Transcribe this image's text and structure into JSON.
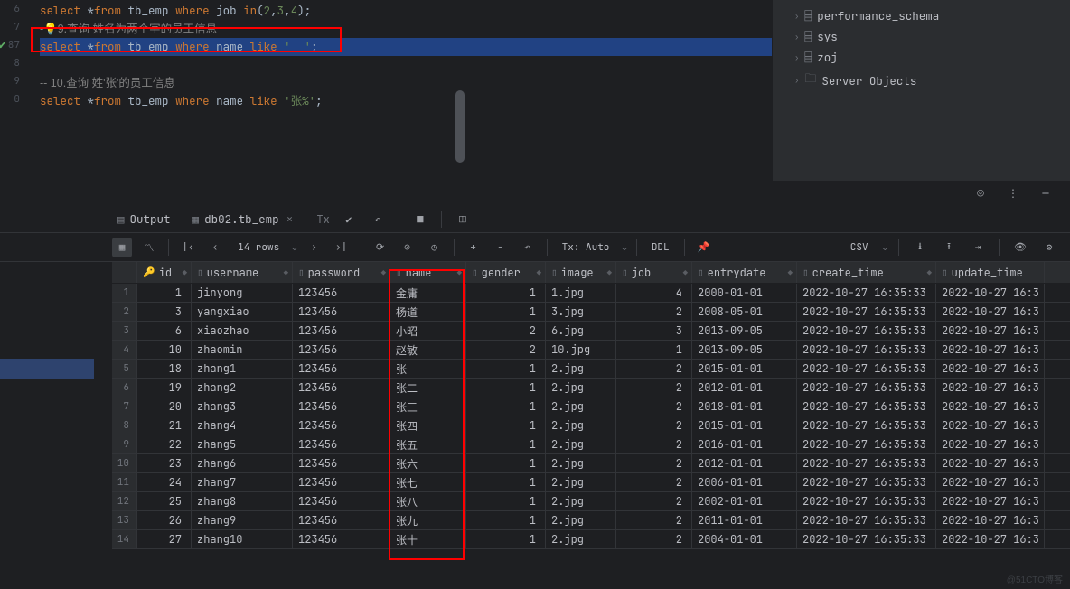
{
  "editor": {
    "lines": [
      {
        "num": "6",
        "pre": "",
        "kw": "select",
        "mid": " *",
        "kw2": "from",
        "mid2": " tb_emp ",
        "kw3": "where",
        "mid3": " job ",
        "kw4": "in",
        "post": "(",
        "str": "2",
        "post2": ",",
        "str2": "3",
        "post3": ",",
        "str3": "4",
        "post4": ");"
      },
      {
        "num": "7",
        "comment": "-💡9.查询 姓名为两个字的员工信息"
      },
      {
        "num": "87",
        "check": true,
        "highlight": true,
        "pre": "",
        "kw": "select",
        "mid": " *",
        "kw2": "from",
        "mid2": " tb_emp ",
        "kw3": "where",
        "mid3": " name ",
        "kw4": "like",
        "post": " ",
        "str": "'__'",
        "post2": ";"
      },
      {
        "num": "8",
        "blank": true
      },
      {
        "num": "9",
        "comment": "-- 10.查询 姓'张'的员工信息"
      },
      {
        "num": "0",
        "pre": "",
        "kw": "select",
        "mid": " *",
        "kw2": "from",
        "mid2": " tb_emp ",
        "kw3": "where",
        "mid3": " name ",
        "kw4": "like",
        "post": " ",
        "str": "'张%'",
        "post2": ";"
      }
    ]
  },
  "sidebar": {
    "items": [
      {
        "label": "performance_schema",
        "icon": "schema"
      },
      {
        "label": "sys",
        "icon": "schema"
      },
      {
        "label": "zoj",
        "icon": "schema"
      },
      {
        "label": "Server Objects",
        "icon": "folder"
      }
    ]
  },
  "tabs": {
    "output_label": "Output",
    "table_label": "db02.tb_emp",
    "tx_label": "Tx"
  },
  "toolbar": {
    "rows_label": "14 rows",
    "tx_auto": "Tx: Auto",
    "ddl": "DDL",
    "csv": "CSV"
  },
  "grid": {
    "columns": [
      "id",
      "username",
      "password",
      "name",
      "gender",
      "image",
      "job",
      "entrydate",
      "create_time",
      "update_time"
    ],
    "rows": [
      {
        "n": "1",
        "id": "1",
        "username": "jinyong",
        "password": "123456",
        "name": "金庸",
        "gender": "1",
        "image": "1.jpg",
        "job": "4",
        "entrydate": "2000-01-01",
        "create": "2022-10-27 16:35:33",
        "update": "2022-10-27 16:3"
      },
      {
        "n": "2",
        "id": "3",
        "username": "yangxiao",
        "password": "123456",
        "name": "杨道",
        "gender": "1",
        "image": "3.jpg",
        "job": "2",
        "entrydate": "2008-05-01",
        "create": "2022-10-27 16:35:33",
        "update": "2022-10-27 16:3"
      },
      {
        "n": "3",
        "id": "6",
        "username": "xiaozhao",
        "password": "123456",
        "name": "小昭",
        "gender": "2",
        "image": "6.jpg",
        "job": "3",
        "entrydate": "2013-09-05",
        "create": "2022-10-27 16:35:33",
        "update": "2022-10-27 16:3"
      },
      {
        "n": "4",
        "id": "10",
        "username": "zhaomin",
        "password": "123456",
        "name": "赵敏",
        "gender": "2",
        "image": "10.jpg",
        "job": "1",
        "entrydate": "2013-09-05",
        "create": "2022-10-27 16:35:33",
        "update": "2022-10-27 16:3"
      },
      {
        "n": "5",
        "id": "18",
        "username": "zhang1",
        "password": "123456",
        "name": "张一",
        "gender": "1",
        "image": "2.jpg",
        "job": "2",
        "entrydate": "2015-01-01",
        "create": "2022-10-27 16:35:33",
        "update": "2022-10-27 16:3"
      },
      {
        "n": "6",
        "id": "19",
        "username": "zhang2",
        "password": "123456",
        "name": "张二",
        "gender": "1",
        "image": "2.jpg",
        "job": "2",
        "entrydate": "2012-01-01",
        "create": "2022-10-27 16:35:33",
        "update": "2022-10-27 16:3"
      },
      {
        "n": "7",
        "id": "20",
        "username": "zhang3",
        "password": "123456",
        "name": "张三",
        "gender": "1",
        "image": "2.jpg",
        "job": "2",
        "entrydate": "2018-01-01",
        "create": "2022-10-27 16:35:33",
        "update": "2022-10-27 16:3"
      },
      {
        "n": "8",
        "id": "21",
        "username": "zhang4",
        "password": "123456",
        "name": "张四",
        "gender": "1",
        "image": "2.jpg",
        "job": "2",
        "entrydate": "2015-01-01",
        "create": "2022-10-27 16:35:33",
        "update": "2022-10-27 16:3"
      },
      {
        "n": "9",
        "id": "22",
        "username": "zhang5",
        "password": "123456",
        "name": "张五",
        "gender": "1",
        "image": "2.jpg",
        "job": "2",
        "entrydate": "2016-01-01",
        "create": "2022-10-27 16:35:33",
        "update": "2022-10-27 16:3"
      },
      {
        "n": "10",
        "id": "23",
        "username": "zhang6",
        "password": "123456",
        "name": "张六",
        "gender": "1",
        "image": "2.jpg",
        "job": "2",
        "entrydate": "2012-01-01",
        "create": "2022-10-27 16:35:33",
        "update": "2022-10-27 16:3"
      },
      {
        "n": "11",
        "id": "24",
        "username": "zhang7",
        "password": "123456",
        "name": "张七",
        "gender": "1",
        "image": "2.jpg",
        "job": "2",
        "entrydate": "2006-01-01",
        "create": "2022-10-27 16:35:33",
        "update": "2022-10-27 16:3"
      },
      {
        "n": "12",
        "id": "25",
        "username": "zhang8",
        "password": "123456",
        "name": "张八",
        "gender": "1",
        "image": "2.jpg",
        "job": "2",
        "entrydate": "2002-01-01",
        "create": "2022-10-27 16:35:33",
        "update": "2022-10-27 16:3"
      },
      {
        "n": "13",
        "id": "26",
        "username": "zhang9",
        "password": "123456",
        "name": "张九",
        "gender": "1",
        "image": "2.jpg",
        "job": "2",
        "entrydate": "2011-01-01",
        "create": "2022-10-27 16:35:33",
        "update": "2022-10-27 16:3"
      },
      {
        "n": "14",
        "id": "27",
        "username": "zhang10",
        "password": "123456",
        "name": "张十",
        "gender": "1",
        "image": "2.jpg",
        "job": "2",
        "entrydate": "2004-01-01",
        "create": "2022-10-27 16:35:33",
        "update": "2022-10-27 16:3"
      }
    ]
  },
  "watermark": "@51CTO博客"
}
